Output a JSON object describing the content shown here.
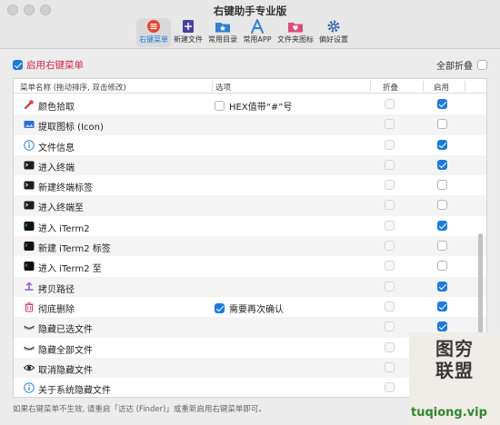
{
  "window": {
    "title": "右键助手专业版"
  },
  "toolbar": {
    "items": [
      {
        "label": "右键菜单",
        "icon": "menu-list-icon",
        "active": true
      },
      {
        "label": "新建文件",
        "icon": "new-file-icon",
        "active": false
      },
      {
        "label": "常用目录",
        "icon": "folder-star-icon",
        "active": false
      },
      {
        "label": "常用APP",
        "icon": "app-store-icon",
        "active": false
      },
      {
        "label": "文件夹图标",
        "icon": "folder-heart-icon",
        "active": false
      },
      {
        "label": "偏好设置",
        "icon": "gear-icon",
        "active": false
      }
    ]
  },
  "controls": {
    "enable_label": "启用右键菜单",
    "enable_checked": true,
    "fold_all_label": "全部折叠",
    "fold_all_checked": false
  },
  "table": {
    "headers": {
      "name": "菜单名称 (拖动排序, 双击修改)",
      "options": "选项",
      "fold": "折叠",
      "enable": "启用"
    },
    "rows": [
      {
        "name": "颜色拾取",
        "icon": "color-picker-icon",
        "option": "HEX值带“#”号",
        "option_checked": false,
        "fold": false,
        "enabled": true
      },
      {
        "name": "提取图标 (Icon)",
        "icon": "image-icon",
        "option": "",
        "option_checked": false,
        "fold": false,
        "enabled": false
      },
      {
        "name": "文件信息",
        "icon": "info-icon",
        "option": "",
        "option_checked": false,
        "fold": false,
        "enabled": true
      },
      {
        "name": "进入终端",
        "icon": "terminal-icon",
        "option": "",
        "option_checked": false,
        "fold": false,
        "enabled": true
      },
      {
        "name": "新建终端标签",
        "icon": "terminal-icon",
        "option": "",
        "option_checked": false,
        "fold": false,
        "enabled": false
      },
      {
        "name": "进入终端至",
        "icon": "terminal-icon",
        "option": "",
        "option_checked": false,
        "fold": false,
        "enabled": false
      },
      {
        "name": "进入 iTerm2",
        "icon": "iterm-icon",
        "option": "",
        "option_checked": false,
        "fold": false,
        "enabled": true
      },
      {
        "name": "新建 iTerm2 标签",
        "icon": "iterm-icon",
        "option": "",
        "option_checked": false,
        "fold": false,
        "enabled": false
      },
      {
        "name": "进入 iTerm2 至",
        "icon": "iterm-icon",
        "option": "",
        "option_checked": false,
        "fold": false,
        "enabled": false
      },
      {
        "name": "拷贝路径",
        "icon": "copy-path-icon",
        "option": "",
        "option_checked": false,
        "fold": false,
        "enabled": true
      },
      {
        "name": "彻底删除",
        "icon": "trash-icon",
        "option": "需要再次确认",
        "option_checked": true,
        "fold": false,
        "enabled": true
      },
      {
        "name": "隐藏已选文件",
        "icon": "closed-eye-icon",
        "option": "",
        "option_checked": false,
        "fold": false,
        "enabled": true
      },
      {
        "name": "隐藏全部文件",
        "icon": "closed-eye-icon",
        "option": "",
        "option_checked": false,
        "fold": false,
        "enabled": false
      },
      {
        "name": "取消隐藏文件",
        "icon": "eye-icon",
        "option": "",
        "option_checked": false,
        "fold": false,
        "enabled": false
      },
      {
        "name": "关于系统隐藏文件",
        "icon": "info-icon",
        "option": "",
        "option_checked": false,
        "fold": false,
        "enabled": false
      }
    ]
  },
  "footer": {
    "note": "如果右键菜单不生效, 请重启「访达 (Finder)」或重新启用右键菜单即可。"
  },
  "watermark": {
    "text": "图穷联盟",
    "url": "tuqiong.vip"
  },
  "colors": {
    "accent": "#1a7be0",
    "enable_label": "#d9244b"
  }
}
